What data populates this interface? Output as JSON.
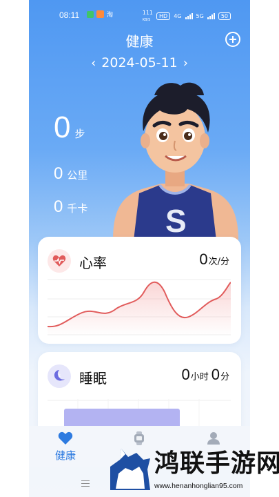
{
  "status_bar": {
    "time": "08:11",
    "notif_text": "淘",
    "net_speed": "111",
    "net_unit": "KB/S",
    "hd": "HD",
    "net1": "4G",
    "net2": "5G",
    "battery": "50"
  },
  "header": {
    "title": "健康"
  },
  "date": {
    "value": "2024-05-11",
    "prev": "‹",
    "next": "›"
  },
  "stats": {
    "steps": {
      "value": "0",
      "unit": "步"
    },
    "distance": {
      "value": "0",
      "unit": "公里"
    },
    "calories": {
      "value": "0",
      "unit": "千卡"
    }
  },
  "heart_rate": {
    "title": "心率",
    "value": "0",
    "unit": "次/分"
  },
  "sleep": {
    "title": "睡眠",
    "hours": "0",
    "hours_unit": "小时",
    "minutes": "0",
    "minutes_unit": "分"
  },
  "tabs": [
    {
      "label": "健康",
      "icon": "heart-icon",
      "active": true
    },
    {
      "label": "",
      "icon": "watch-icon",
      "active": false
    },
    {
      "label": "",
      "icon": "person-icon",
      "active": false
    }
  ],
  "watermark": {
    "text": "鸿联手游网",
    "url": "www.henanhonglian95.com"
  },
  "colors": {
    "accent": "#2e7be0",
    "heart": "#e15b5b",
    "sleep": "#6b6be0"
  }
}
